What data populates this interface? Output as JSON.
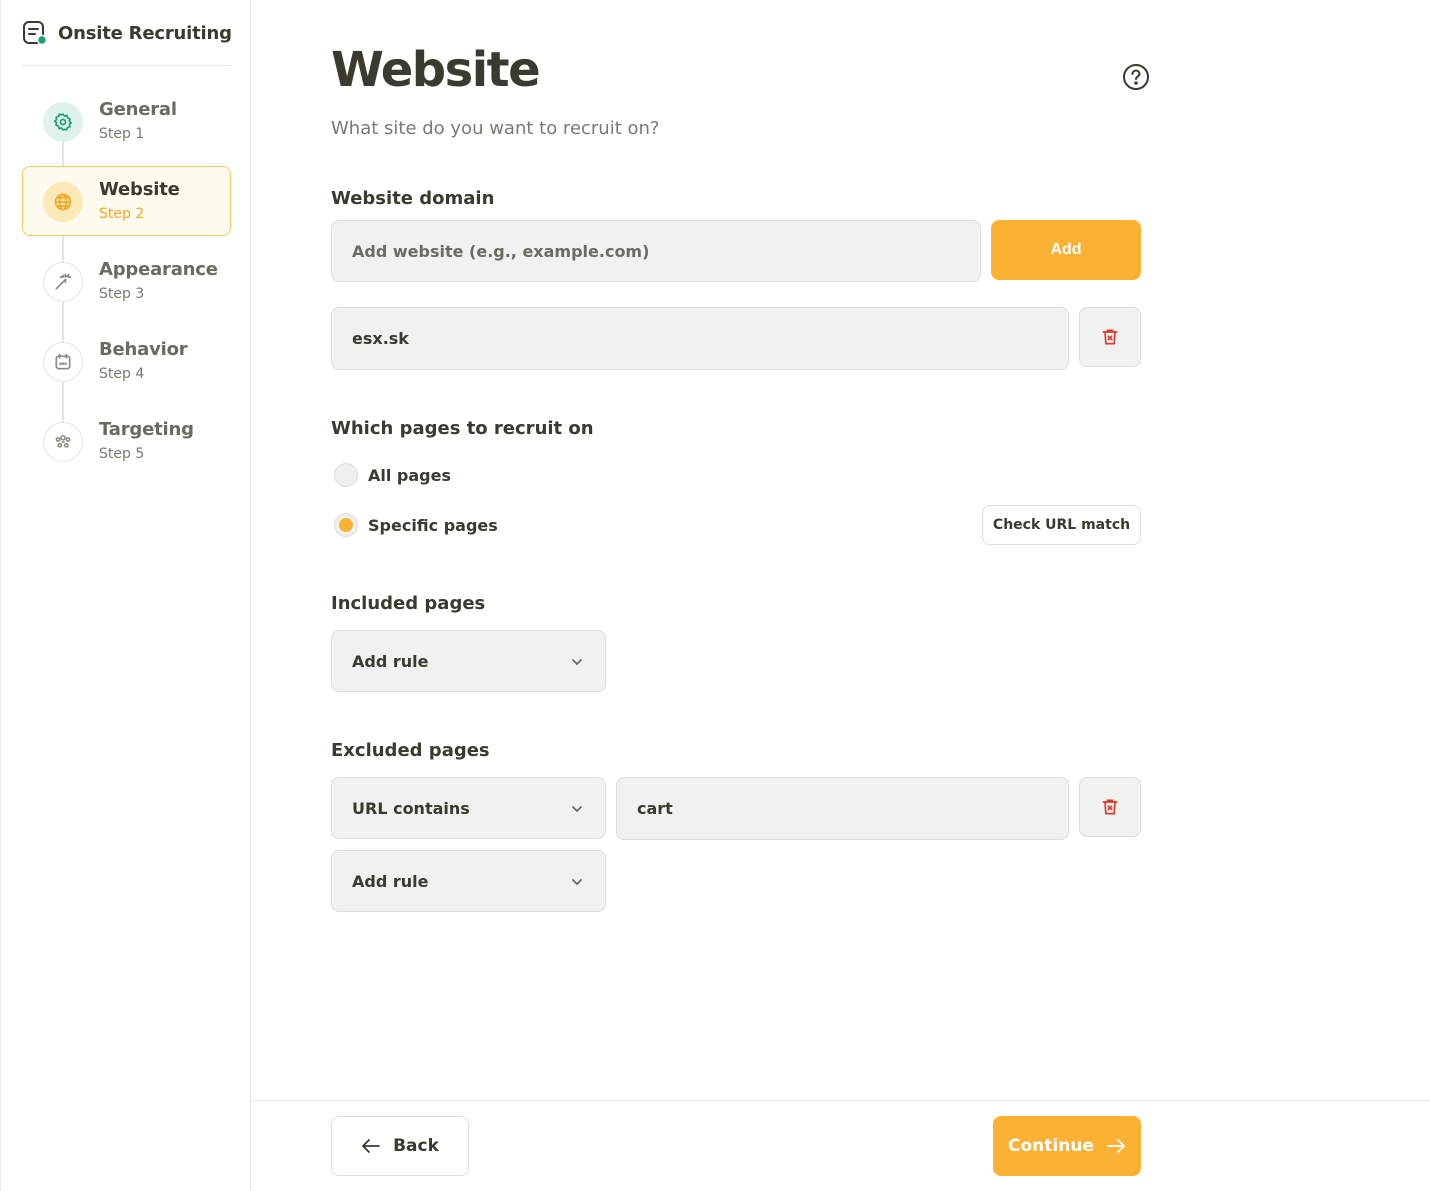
{
  "app": {
    "title": "Onsite Recruiting"
  },
  "steps": [
    {
      "name": "General",
      "step": "Step 1",
      "state": "done",
      "icon": "gear-icon"
    },
    {
      "name": "Website",
      "step": "Step 2",
      "state": "active",
      "icon": "globe-icon"
    },
    {
      "name": "Appearance",
      "step": "Step 3",
      "state": "todo",
      "icon": "magic-wand-icon"
    },
    {
      "name": "Behavior",
      "step": "Step 4",
      "state": "todo",
      "icon": "calendar-icon"
    },
    {
      "name": "Targeting",
      "step": "Step 5",
      "state": "todo",
      "icon": "users-icon"
    }
  ],
  "page": {
    "title": "Website",
    "subtitle": "What site do you want to recruit on?"
  },
  "domain": {
    "label": "Website domain",
    "input_placeholder": "Add website (e.g., example.com)",
    "add_label": "Add",
    "entries": [
      "esx.sk"
    ]
  },
  "pages": {
    "label": "Which pages to recruit on",
    "options": [
      {
        "label": "All pages",
        "selected": false
      },
      {
        "label": "Specific pages",
        "selected": true
      }
    ],
    "check_url_label": "Check URL match"
  },
  "included": {
    "label": "Included pages",
    "add_rule_label": "Add rule"
  },
  "excluded": {
    "label": "Excluded pages",
    "rules": [
      {
        "condition": "URL contains",
        "value": "cart"
      }
    ],
    "add_rule_label": "Add rule"
  },
  "footer": {
    "back_label": "Back",
    "continue_label": "Continue"
  },
  "colors": {
    "accent": "#fbb234",
    "accent_text": "#f5a623",
    "done": "#1f9e6e",
    "danger": "#e0392d",
    "text": "#3a3a2e"
  }
}
